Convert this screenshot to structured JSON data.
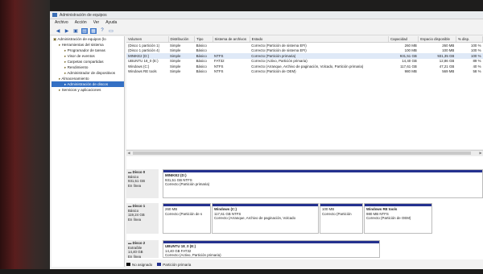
{
  "window": {
    "title": "Administración de equipos"
  },
  "menubar": [
    "Archivo",
    "Acción",
    "Ver",
    "Ayuda"
  ],
  "toolbar": {
    "icons": [
      "back-arrow-icon",
      "forward-arrow-icon",
      "up-folder-icon",
      "console-tree-icon",
      "properties-icon",
      "help-icon",
      "refresh-icon"
    ]
  },
  "tree": {
    "items": [
      {
        "label": "Administración de equipos (lo",
        "depth": 0,
        "selected": false
      },
      {
        "label": "Herramientas del sistema",
        "depth": 1,
        "selected": false
      },
      {
        "label": "Programador de tareas",
        "depth": 2,
        "selected": false
      },
      {
        "label": "Visor de eventos",
        "depth": 2,
        "selected": false
      },
      {
        "label": "Carpetas compartidas",
        "depth": 2,
        "selected": false
      },
      {
        "label": "Rendimiento",
        "depth": 2,
        "selected": false
      },
      {
        "label": "Administrador de dispositivos",
        "depth": 2,
        "selected": false
      },
      {
        "label": "Almacenamiento",
        "depth": 1,
        "selected": false
      },
      {
        "label": "Administración de discos",
        "depth": 2,
        "selected": true
      },
      {
        "label": "Servicios y aplicaciones",
        "depth": 1,
        "selected": false
      }
    ]
  },
  "volumes": {
    "columns": [
      "Volumen",
      "Distribución",
      "Tipo",
      "Sistema de archivos",
      "Estado",
      "Capacidad",
      "Espacio disponible",
      "% disp."
    ],
    "rows": [
      [
        "(Disco 1 partición 1)",
        "Simple",
        "Básico",
        "",
        "Correcto (Partición de sistema EFI)",
        "260 MB",
        "260 MB",
        "100 %"
      ],
      [
        "(Disco 1 partición 4)",
        "Simple",
        "Básico",
        "",
        "Correcto (Partición de sistema EFI)",
        "100 MB",
        "100 MB",
        "100 %"
      ],
      [
        "MINIKE2 (D:)",
        "Simple",
        "Básico",
        "NTFS",
        "Correcto (Partición primaria)",
        "931,51 GB",
        "931,35 GB",
        "100 %"
      ],
      [
        "UBUNTU 18_0 (E:)",
        "Simple",
        "Básico",
        "FAT32",
        "Correcto (Activo, Partición primaria)",
        "14,40 GB",
        "12,86 GB",
        "89 %"
      ],
      [
        "Windows (C:)",
        "Simple",
        "Básico",
        "NTFS",
        "Correcto (Arranque, Archivo de paginación, Volcado, Partición primaria)",
        "117,61 GB",
        "47,21 GB",
        "40 %"
      ],
      [
        "Windows RE tools",
        "Simple",
        "Básico",
        "NTFS",
        "Correcto (Partición de OEM)",
        "980 MB",
        "569 MB",
        "58 %"
      ]
    ]
  },
  "disks": [
    {
      "name": "Disco 0",
      "type": "Básico",
      "size": "931,51 GB",
      "status": "En línea",
      "partitions": [
        {
          "name": "MINIKE2 (D:)",
          "size": "931,51 GB NTFS",
          "status": "Correcto (Partición primaria)"
        }
      ]
    },
    {
      "name": "Disco 1",
      "type": "Básico",
      "size": "119,24 GB",
      "status": "En línea",
      "partitions": [
        {
          "name": "",
          "size": "260 MB",
          "status": "Correcto (Partición de s"
        },
        {
          "name": "Windows (C:)",
          "size": "117,61 GB NTFS",
          "status": "Correcto (Arranque, Archivo de paginación, Volcado"
        },
        {
          "name": "",
          "size": "100 MB",
          "status": "Correcto (Partición"
        },
        {
          "name": "Windows RE tools",
          "size": "980 MB NTFS",
          "status": "Correcto (Partición de OEM)"
        }
      ]
    },
    {
      "name": "Disco 2",
      "type": "Extraíble",
      "size": "14,40 GB",
      "status": "En línea",
      "partitions": [
        {
          "name": "UBUNTU 18_0 (E:)",
          "size": "14,40 GB FAT32",
          "status": "Correcto (Activo, Partición primaria)"
        }
      ]
    }
  ],
  "legend": [
    {
      "label": "No asignado",
      "color": "#111111"
    },
    {
      "label": "Partición primaria",
      "color": "#24318f"
    }
  ],
  "colors": {
    "partition_bar": "#24318f",
    "selection": "#3470c4"
  }
}
